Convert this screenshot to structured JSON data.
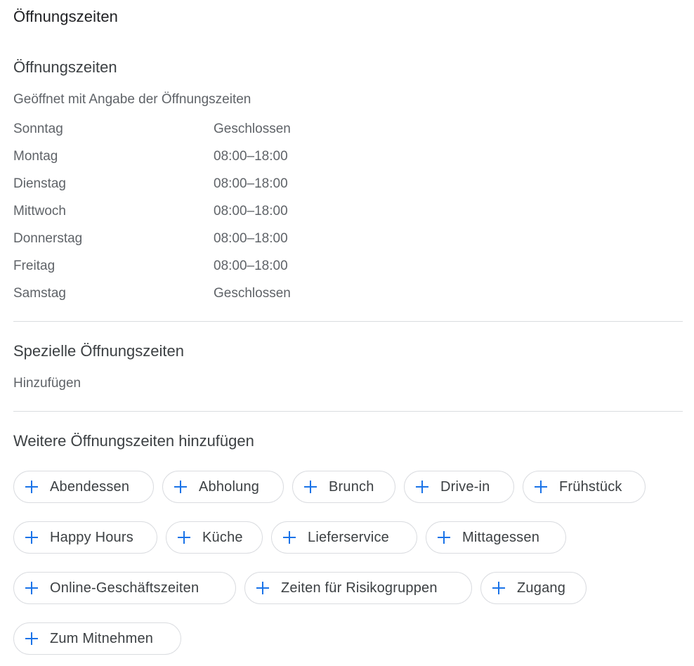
{
  "page": {
    "title": "Öffnungszeiten"
  },
  "regular_hours": {
    "title": "Öffnungszeiten",
    "status": "Geöffnet mit Angabe der Öffnungszeiten",
    "days": [
      {
        "day": "Sonntag",
        "hours": "Geschlossen"
      },
      {
        "day": "Montag",
        "hours": "08:00–18:00"
      },
      {
        "day": "Dienstag",
        "hours": "08:00–18:00"
      },
      {
        "day": "Mittwoch",
        "hours": "08:00–18:00"
      },
      {
        "day": "Donnerstag",
        "hours": "08:00–18:00"
      },
      {
        "day": "Freitag",
        "hours": "08:00–18:00"
      },
      {
        "day": "Samstag",
        "hours": "Geschlossen"
      }
    ]
  },
  "special_hours": {
    "title": "Spezielle Öffnungszeiten",
    "add_label": "Hinzufügen"
  },
  "more_hours": {
    "title": "Weitere Öffnungszeiten hinzufügen",
    "accent_color": "#1a73e8",
    "icon": "plus-icon",
    "chips": [
      "Abendessen",
      "Abholung",
      "Brunch",
      "Drive-in",
      "Frühstück",
      "Happy Hours",
      "Küche",
      "Lieferservice",
      "Mittagessen",
      "Online-Geschäftszeiten",
      "Zeiten für Risikogruppen",
      "Zugang",
      "Zum Mitnehmen"
    ]
  }
}
